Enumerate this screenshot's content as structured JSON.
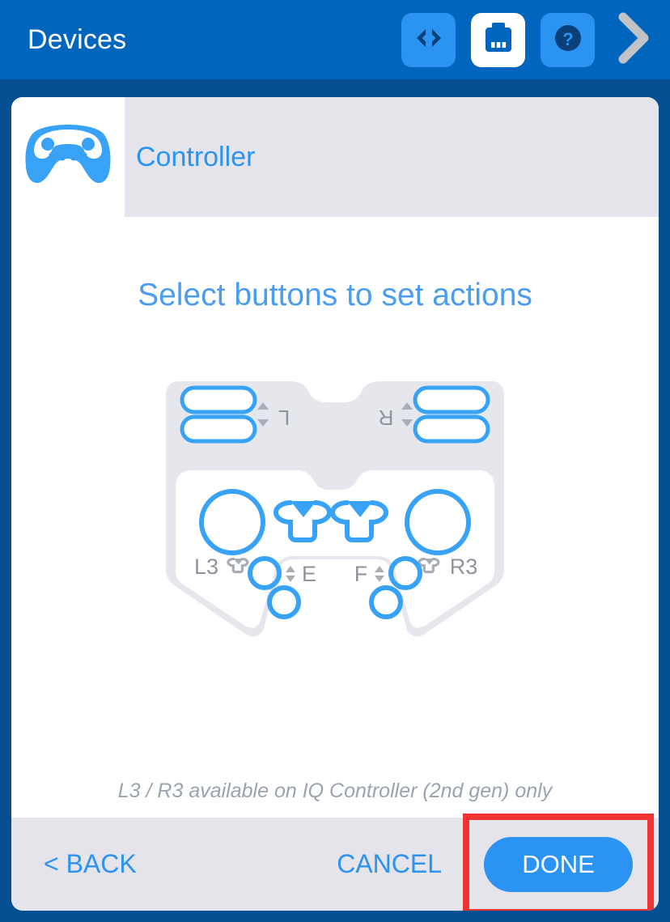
{
  "appbar": {
    "title": "Devices",
    "actions": [
      {
        "name": "code-icon",
        "style": "tinted"
      },
      {
        "name": "brain-device-icon",
        "style": "solid"
      },
      {
        "name": "help-question-icon",
        "style": "tinted"
      }
    ],
    "next_chevron": "chevron-right-icon"
  },
  "card": {
    "device_icon": "gamepad-icon",
    "device_name": "Controller",
    "heading": "Select buttons to set actions",
    "footnote": "L3 / R3 available on IQ Controller (2nd gen) only",
    "footer": {
      "back_label": "< BACK",
      "cancel_label": "CANCEL",
      "done_label": "DONE"
    }
  },
  "controller": {
    "labels": {
      "shoulder_left": "L",
      "shoulder_right": "R",
      "stick_left": "L3",
      "stick_right": "R3",
      "button_left_pair": "E",
      "button_right_pair": "F"
    }
  },
  "colors": {
    "appbar_blue": "#0066bd",
    "page_blue": "#054f92",
    "accent_blue": "#2b94f2",
    "heading_blue": "#4a9df0",
    "chrome_gray": "#e4e4ea",
    "pad_body_gray": "#e6e7ec",
    "label_gray": "#9aa3b0",
    "highlight_red": "#f03434"
  }
}
